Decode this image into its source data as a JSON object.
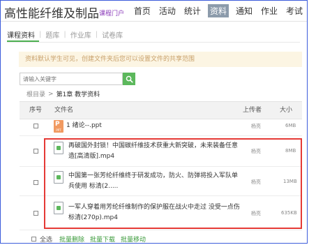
{
  "header": {
    "site_title": "高性能纤维及制品",
    "portal_label": "课程门户",
    "nav": [
      {
        "label": "首页",
        "active": false
      },
      {
        "label": "活动",
        "active": false
      },
      {
        "label": "统计",
        "active": false
      },
      {
        "label": "资料",
        "active": true
      },
      {
        "label": "通知",
        "active": false
      },
      {
        "label": "作业",
        "active": false
      },
      {
        "label": "考试",
        "active": false
      }
    ]
  },
  "tabs": [
    {
      "label": "课程资料",
      "active": true
    },
    {
      "label": "题库",
      "active": false
    },
    {
      "label": "作业库",
      "active": false
    },
    {
      "label": "试卷库",
      "active": false
    }
  ],
  "notice": "资料默认学生可见，创建文件夹后您可以设置文件的共享范围",
  "search": {
    "placeholder": "请输入关键字"
  },
  "breadcrumb": {
    "root": "根目录",
    "separator": ">",
    "current": "第1章 教学资料"
  },
  "table": {
    "headers": {
      "seq": "序号",
      "filename": "文件名",
      "uploader": "上传者",
      "size": "大小"
    },
    "rows": [
      {
        "type": "ppt",
        "name": "1 绪论--.ppt",
        "uploader": "杨亮",
        "size": "6MB"
      },
      {
        "type": "mp4",
        "name": "再破国外封锁！中国碳纤维技术获重大新突破，未来装备任意造[高清版].mp4",
        "uploader": "杨亮",
        "size": "8MB"
      },
      {
        "type": "mp4",
        "name": "中国第一张芳纶纤维终于研发成功，防火、防弹将投入军队单兵使用 标清(2.....",
        "uploader": "杨亮",
        "size": "13MB"
      },
      {
        "type": "mp4",
        "name": "一军人穿着用芳纶纤维制作的保护服在战火中走过 没受一点伤 标清(270p).mp4",
        "uploader": "杨亮",
        "size": "635KB"
      }
    ]
  },
  "bottom_actions": {
    "select_all": "全选",
    "batch_delete": "批量删除",
    "batch_download": "批量下载",
    "batch_move": "批量移动"
  },
  "colors": {
    "accent_green": "#5cb85c",
    "nav_active_bg": "#8c9bab",
    "notice_bg": "#fcf5e3",
    "highlight_border": "#e53935",
    "portal_purple": "#8a3ab9"
  }
}
